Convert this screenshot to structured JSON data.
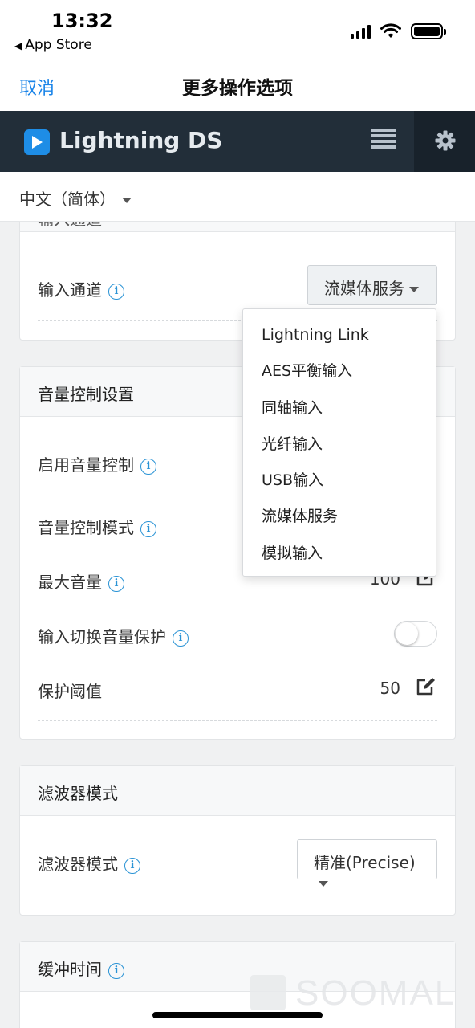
{
  "status_bar": {
    "time": "13:32",
    "back_app": "App Store"
  },
  "nav": {
    "cancel": "取消",
    "title": "更多操作选项"
  },
  "app": {
    "name": "Lightning DS",
    "brand_color": "#1e8de6",
    "header_color": "#222e39"
  },
  "language": {
    "selected": "中文（简体）"
  },
  "input_card": {
    "header_partial": "输入通道",
    "input_channel": {
      "label": "输入通道",
      "value": "流媒体服务"
    }
  },
  "dropdown": {
    "options": [
      "Lightning Link",
      "AES平衡输入",
      "同轴输入",
      "光纤输入",
      "USB输入",
      "流媒体服务",
      "模拟输入"
    ]
  },
  "volume_card": {
    "header": "音量控制设置",
    "enable_label": "启用音量控制",
    "mode_label": "音量控制模式",
    "max_label": "最大音量",
    "max_value": "100",
    "protect_label": "输入切换音量保护",
    "protect_on": false,
    "threshold_label": "保护阈值",
    "threshold_value": "50"
  },
  "filter_card": {
    "header": "滤波器模式",
    "label": "滤波器模式",
    "value": "精准(Precise)"
  },
  "buffer_card": {
    "header": "缓冲时间"
  },
  "watermark": {
    "text": "SOOMAL"
  }
}
